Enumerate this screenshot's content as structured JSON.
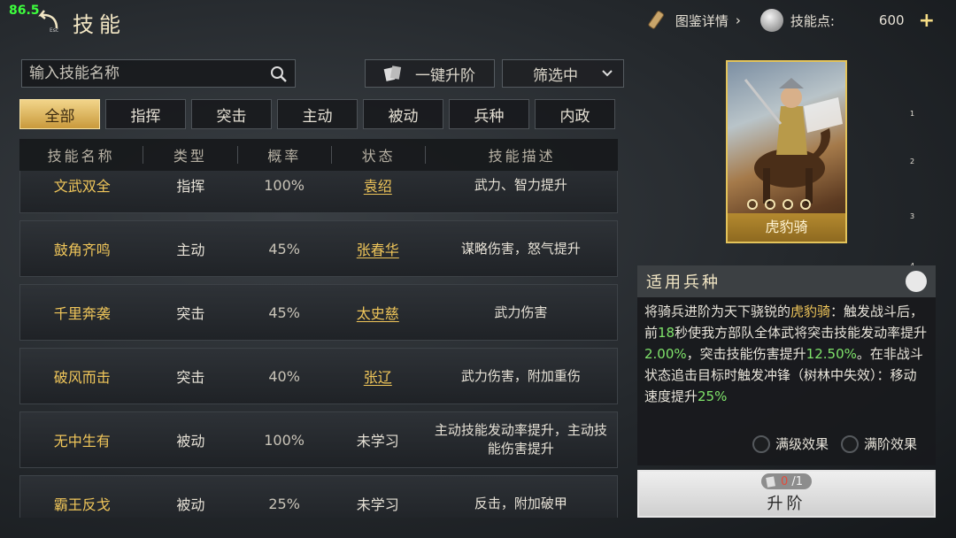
{
  "overlay": {
    "fps": "86.5"
  },
  "header": {
    "title": "技能",
    "esc_label": "Esc",
    "codex_label": "图鉴详情",
    "points_label": "技能点:",
    "points_value": "600",
    "plus_label": "+"
  },
  "toolbar": {
    "search_placeholder": "输入技能名称",
    "upgrade_all_label": "一键升阶",
    "filter_label": "筛选中"
  },
  "tabs": [
    {
      "label": "全部",
      "active": true
    },
    {
      "label": "指挥"
    },
    {
      "label": "突击"
    },
    {
      "label": "主动"
    },
    {
      "label": "被动"
    },
    {
      "label": "兵种"
    },
    {
      "label": "内政"
    }
  ],
  "table": {
    "headers": [
      "技能名称",
      "类型",
      "概率",
      "状态",
      "技能描述"
    ],
    "rows": [
      {
        "name": "文武双全",
        "type": "指挥",
        "prob": "100%",
        "state": "袁绍",
        "state_link": true,
        "desc": "武力、智力提升"
      },
      {
        "name": "鼓角齐鸣",
        "type": "主动",
        "prob": "45%",
        "state": "张春华",
        "state_link": true,
        "desc": "谋略伤害，怒气提升"
      },
      {
        "name": "千里奔袭",
        "type": "突击",
        "prob": "45%",
        "state": "太史慈",
        "state_link": true,
        "desc": "武力伤害"
      },
      {
        "name": "破风而击",
        "type": "突击",
        "prob": "40%",
        "state": "张辽",
        "state_link": true,
        "desc": "武力伤害，附加重伤"
      },
      {
        "name": "无中生有",
        "type": "被动",
        "prob": "100%",
        "state": "未学习",
        "state_link": false,
        "desc": "主动技能发动率提升，主动技能伤害提升"
      },
      {
        "name": "霸王反戈",
        "type": "被动",
        "prob": "25%",
        "state": "未学习",
        "state_link": false,
        "desc": "反击，附加破甲"
      }
    ]
  },
  "card": {
    "name": "虎豹骑",
    "stars": 4
  },
  "page_indicators": [
    "1",
    "2",
    "3",
    "4"
  ],
  "unit_panel": {
    "title": "适用兵种",
    "desc_parts": [
      {
        "t": "将骑兵进阶为天下骁锐的",
        "c": ""
      },
      {
        "t": "虎豹骑",
        "c": "gold"
      },
      {
        "t": "：触发战斗后，前",
        "c": ""
      },
      {
        "t": "18",
        "c": "green"
      },
      {
        "t": "秒使我方部队全体武将突击技能发动率提升",
        "c": ""
      },
      {
        "t": "2.00%",
        "c": "green"
      },
      {
        "t": "，突击技能伤害提升",
        "c": ""
      },
      {
        "t": "12.50%",
        "c": "green"
      },
      {
        "t": "。在非战斗状态追击目标时触发冲锋（树林中失效）：移动速度提升",
        "c": ""
      },
      {
        "t": "25%",
        "c": "green"
      }
    ],
    "toggle_max_level": "满级效果",
    "toggle_max_rank": "满阶效果"
  },
  "ascend": {
    "have": "0",
    "need": "/1",
    "label": "升阶"
  },
  "colors": {
    "gold": "#f0c65a",
    "green": "#7fe36a",
    "accent": "#e3c35a"
  }
}
